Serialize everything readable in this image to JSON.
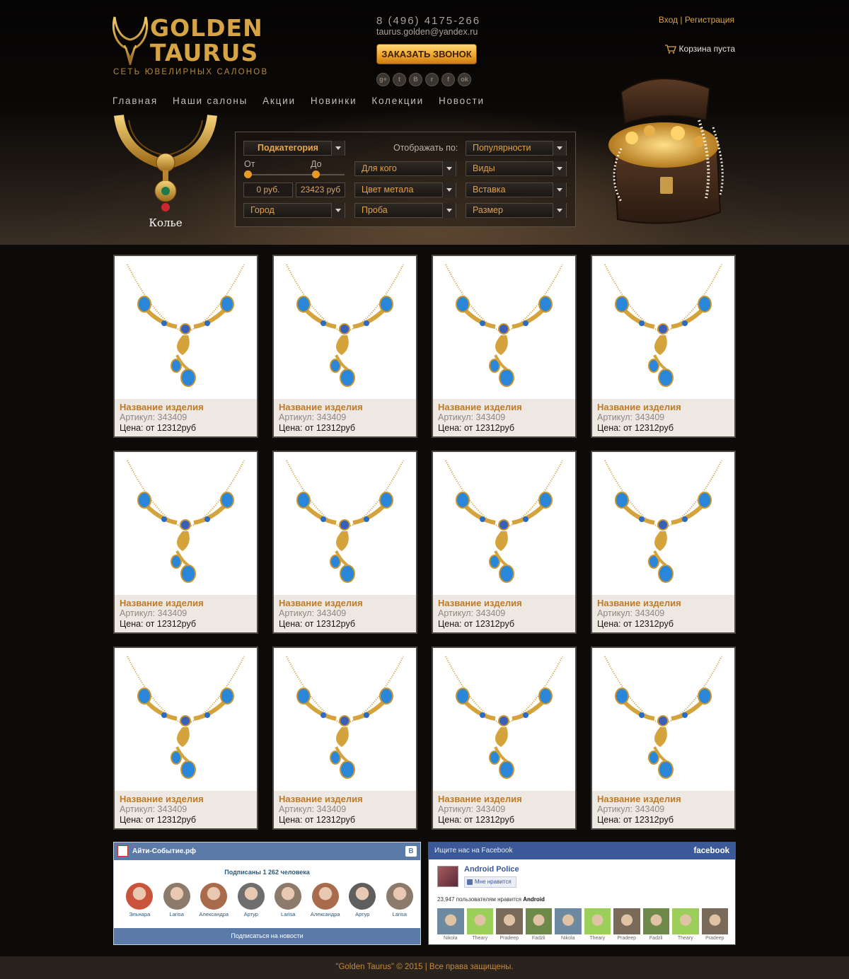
{
  "brand": {
    "line1": "GOLDEN",
    "line2": "TAURUS",
    "tagline": "СЕТЬ ЮВЕЛИРНЫХ САЛОНОВ"
  },
  "contact": {
    "phone": "8 (496) 4175-266",
    "email": "taurus.golden@yandex.ru",
    "callback_label": "ЗАКАЗАТЬ ЗВОНОК"
  },
  "socials": [
    {
      "icon": "google-plus-icon",
      "glyph": "g+"
    },
    {
      "icon": "twitter-icon",
      "glyph": "t"
    },
    {
      "icon": "vk-icon",
      "glyph": "B"
    },
    {
      "icon": "rss-icon",
      "glyph": "r"
    },
    {
      "icon": "facebook-icon",
      "glyph": "f"
    },
    {
      "icon": "odnoklassniki-icon",
      "glyph": "ok"
    }
  ],
  "auth": {
    "login": "Вход",
    "separator": "|",
    "register": "Регистрация"
  },
  "cart": {
    "label": "Корзина пуста"
  },
  "nav": [
    "Главная",
    "Наши салоны",
    "Акции",
    "Новинки",
    "Колекции",
    "Новости"
  ],
  "category": {
    "label": "Колье"
  },
  "filters": {
    "subcategory": "Подкатегория",
    "sort_label": "Отображать по:",
    "sort_value": "Популярности",
    "from_label": "От",
    "to_label": "До",
    "from_value": "0 руб.",
    "to_value": "23423 руб",
    "city": "Город",
    "for_whom": "Для кого",
    "metal": "Цвет метала",
    "assay": "Проба",
    "kinds": "Виды",
    "insert": "Вставка",
    "size": "Размер"
  },
  "products": [
    {
      "title": "Название изделия",
      "article": "Артикул: 343409",
      "price": "Цена: от 12312руб"
    },
    {
      "title": "Название изделия",
      "article": "Артикул: 343409",
      "price": "Цена: от 12312руб"
    },
    {
      "title": "Название изделия",
      "article": "Артикул: 343409",
      "price": "Цена: от 12312руб"
    },
    {
      "title": "Название изделия",
      "article": "Артикул: 343409",
      "price": "Цена: от 12312руб"
    },
    {
      "title": "Название изделия",
      "article": "Артикул: 343409",
      "price": "Цена: от 12312руб"
    },
    {
      "title": "Название изделия",
      "article": "Артикул: 343409",
      "price": "Цена: от 12312руб"
    },
    {
      "title": "Название изделия",
      "article": "Артикул: 343409",
      "price": "Цена: от 12312руб"
    },
    {
      "title": "Название изделия",
      "article": "Артикул: 343409",
      "price": "Цена: от 12312руб"
    },
    {
      "title": "Название изделия",
      "article": "Артикул: 343409",
      "price": "Цена: от 12312руб"
    },
    {
      "title": "Название изделия",
      "article": "Артикул: 343409",
      "price": "Цена: от 12312руб"
    },
    {
      "title": "Название изделия",
      "article": "Артикул: 343409",
      "price": "Цена: от 12312руб"
    },
    {
      "title": "Название изделия",
      "article": "Артикул: 343409",
      "price": "Цена: от 12312руб"
    }
  ],
  "vk_widget": {
    "title": "Айти-Событие.рф",
    "subscribers": "Подписаны 1 262 человека",
    "people": [
      "Эльнара",
      "Larisa",
      "Александра",
      "Артур",
      "Larisa",
      "Александра",
      "Артур",
      "Larisa"
    ],
    "subscribe_label": "Подписаться на новости"
  },
  "fb_widget": {
    "header": "Ищите нас на Facebook",
    "brand": "facebook",
    "page_name": "Android Police",
    "like_label": "Мне нравится",
    "likes_text": "23,947 пользователям нравится",
    "likes_subject": "Android",
    "faces": [
      "Nikola",
      "Theary",
      "Pradeep",
      "Fadzli",
      "Nikola",
      "Theary",
      "Pradeep",
      "Fadzli",
      "Theary",
      "Pradeep"
    ]
  },
  "footer": {
    "text": "\"Golden Taurus\" © 2015  |  Все права защищены."
  },
  "colors": {
    "accent": "#d6a445",
    "product_title": "#bf7a26",
    "vk_blue": "#5a7ba8",
    "fb_blue": "#3b5998"
  }
}
